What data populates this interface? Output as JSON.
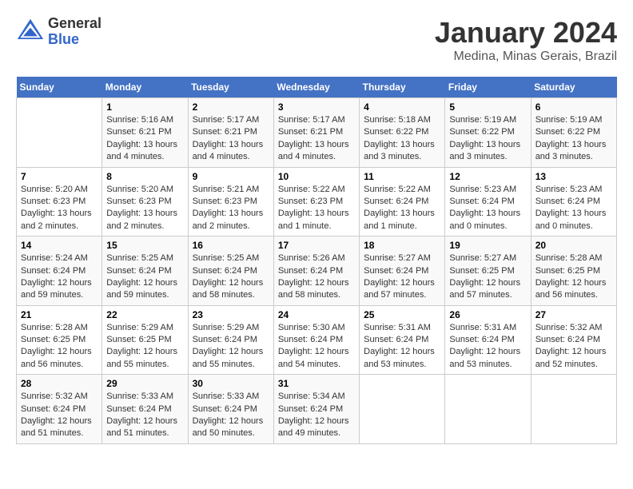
{
  "logo": {
    "general": "General",
    "blue": "Blue"
  },
  "header": {
    "month": "January 2024",
    "location": "Medina, Minas Gerais, Brazil"
  },
  "weekdays": [
    "Sunday",
    "Monday",
    "Tuesday",
    "Wednesday",
    "Thursday",
    "Friday",
    "Saturday"
  ],
  "weeks": [
    [
      {
        "day": "",
        "info": ""
      },
      {
        "day": "1",
        "info": "Sunrise: 5:16 AM\nSunset: 6:21 PM\nDaylight: 13 hours\nand 4 minutes."
      },
      {
        "day": "2",
        "info": "Sunrise: 5:17 AM\nSunset: 6:21 PM\nDaylight: 13 hours\nand 4 minutes."
      },
      {
        "day": "3",
        "info": "Sunrise: 5:17 AM\nSunset: 6:21 PM\nDaylight: 13 hours\nand 4 minutes."
      },
      {
        "day": "4",
        "info": "Sunrise: 5:18 AM\nSunset: 6:22 PM\nDaylight: 13 hours\nand 3 minutes."
      },
      {
        "day": "5",
        "info": "Sunrise: 5:19 AM\nSunset: 6:22 PM\nDaylight: 13 hours\nand 3 minutes."
      },
      {
        "day": "6",
        "info": "Sunrise: 5:19 AM\nSunset: 6:22 PM\nDaylight: 13 hours\nand 3 minutes."
      }
    ],
    [
      {
        "day": "7",
        "info": ""
      },
      {
        "day": "8",
        "info": "Sunrise: 5:20 AM\nSunset: 6:23 PM\nDaylight: 13 hours\nand 2 minutes."
      },
      {
        "day": "9",
        "info": "Sunrise: 5:21 AM\nSunset: 6:23 PM\nDaylight: 13 hours\nand 2 minutes."
      },
      {
        "day": "10",
        "info": "Sunrise: 5:22 AM\nSunset: 6:23 PM\nDaylight: 13 hours\nand 1 minute."
      },
      {
        "day": "11",
        "info": "Sunrise: 5:22 AM\nSunset: 6:24 PM\nDaylight: 13 hours\nand 1 minute."
      },
      {
        "day": "12",
        "info": "Sunrise: 5:23 AM\nSunset: 6:24 PM\nDaylight: 13 hours\nand 0 minutes."
      },
      {
        "day": "13",
        "info": "Sunrise: 5:23 AM\nSunset: 6:24 PM\nDaylight: 13 hours\nand 0 minutes."
      }
    ],
    [
      {
        "day": "14",
        "info": ""
      },
      {
        "day": "15",
        "info": "Sunrise: 5:25 AM\nSunset: 6:24 PM\nDaylight: 12 hours\nand 59 minutes."
      },
      {
        "day": "16",
        "info": "Sunrise: 5:25 AM\nSunset: 6:24 PM\nDaylight: 12 hours\nand 58 minutes."
      },
      {
        "day": "17",
        "info": "Sunrise: 5:26 AM\nSunset: 6:24 PM\nDaylight: 12 hours\nand 58 minutes."
      },
      {
        "day": "18",
        "info": "Sunrise: 5:27 AM\nSunset: 6:24 PM\nDaylight: 12 hours\nand 57 minutes."
      },
      {
        "day": "19",
        "info": "Sunrise: 5:27 AM\nSunset: 6:25 PM\nDaylight: 12 hours\nand 57 minutes."
      },
      {
        "day": "20",
        "info": "Sunrise: 5:28 AM\nSunset: 6:25 PM\nDaylight: 12 hours\nand 56 minutes."
      }
    ],
    [
      {
        "day": "21",
        "info": ""
      },
      {
        "day": "22",
        "info": "Sunrise: 5:29 AM\nSunset: 6:25 PM\nDaylight: 12 hours\nand 55 minutes."
      },
      {
        "day": "23",
        "info": "Sunrise: 5:29 AM\nSunset: 6:24 PM\nDaylight: 12 hours\nand 55 minutes."
      },
      {
        "day": "24",
        "info": "Sunrise: 5:30 AM\nSunset: 6:24 PM\nDaylight: 12 hours\nand 54 minutes."
      },
      {
        "day": "25",
        "info": "Sunrise: 5:31 AM\nSunset: 6:24 PM\nDaylight: 12 hours\nand 53 minutes."
      },
      {
        "day": "26",
        "info": "Sunrise: 5:31 AM\nSunset: 6:24 PM\nDaylight: 12 hours\nand 53 minutes."
      },
      {
        "day": "27",
        "info": "Sunrise: 5:32 AM\nSunset: 6:24 PM\nDaylight: 12 hours\nand 52 minutes."
      }
    ],
    [
      {
        "day": "28",
        "info": "Sunrise: 5:32 AM\nSunset: 6:24 PM\nDaylight: 12 hours\nand 51 minutes."
      },
      {
        "day": "29",
        "info": "Sunrise: 5:33 AM\nSunset: 6:24 PM\nDaylight: 12 hours\nand 51 minutes."
      },
      {
        "day": "30",
        "info": "Sunrise: 5:33 AM\nSunset: 6:24 PM\nDaylight: 12 hours\nand 50 minutes."
      },
      {
        "day": "31",
        "info": "Sunrise: 5:34 AM\nSunset: 6:24 PM\nDaylight: 12 hours\nand 49 minutes."
      },
      {
        "day": "",
        "info": ""
      },
      {
        "day": "",
        "info": ""
      },
      {
        "day": "",
        "info": ""
      }
    ]
  ],
  "week1_day7_info": "Sunrise: 5:20 AM\nSunset: 6:23 PM\nDaylight: 13 hours\nand 2 minutes.",
  "week3_day14_info": "Sunrise: 5:24 AM\nSunset: 6:24 PM\nDaylight: 12 hours\nand 59 minutes.",
  "week4_day21_info": "Sunrise: 5:28 AM\nSunset: 6:25 PM\nDaylight: 12 hours\nand 56 minutes."
}
